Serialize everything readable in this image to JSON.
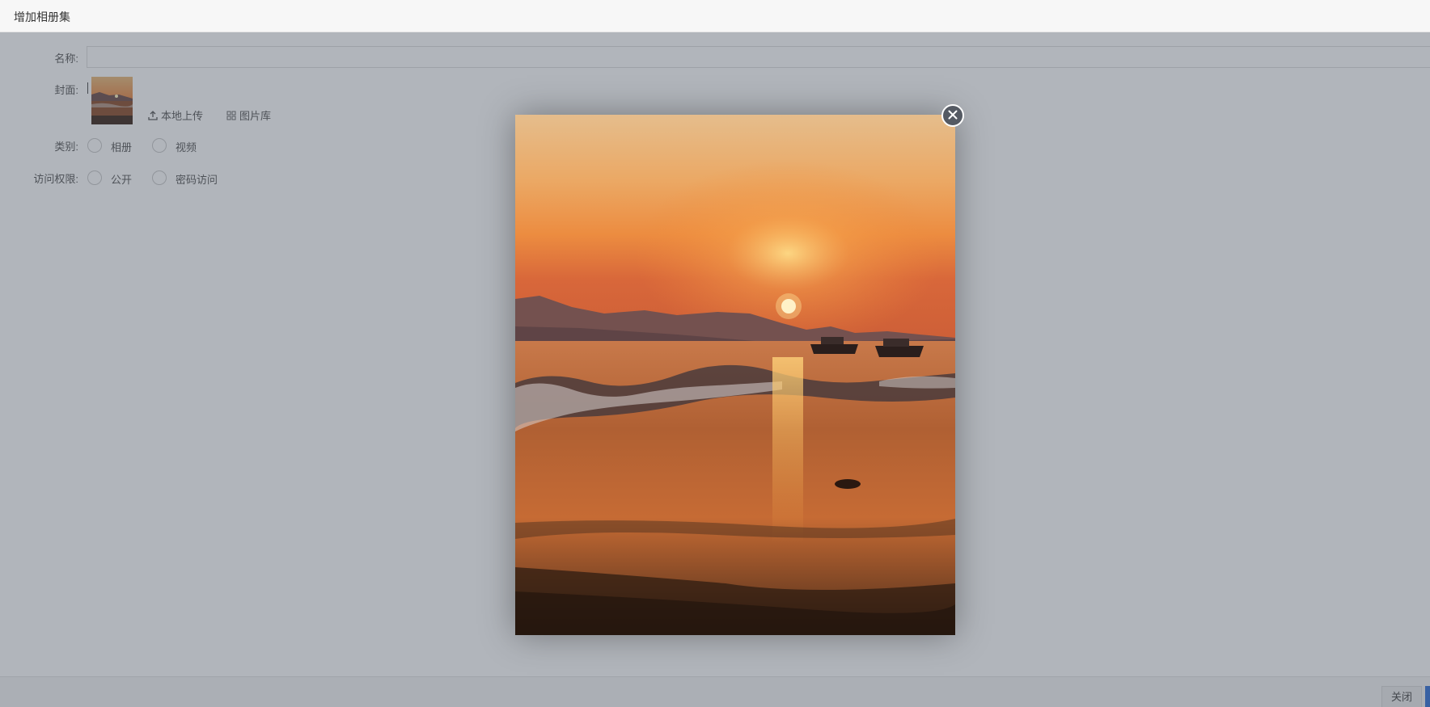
{
  "window": {
    "title": "增加相册集"
  },
  "form": {
    "name_label": "名称:",
    "name_value": "",
    "cover_label": "封面:",
    "upload_local_label": "本地上传",
    "gallery_label": "图片库",
    "category_label": "类别:",
    "category_options": [
      "相册",
      "视频"
    ],
    "access_label": "访问权限:",
    "access_options": [
      "公开",
      "密码访问"
    ]
  },
  "footer": {
    "close_label": "关闭"
  },
  "icons": {
    "upload": "upload-icon",
    "gallery": "grid-icon",
    "preview_close": "close-icon"
  },
  "colors": {
    "overlay": "#464e5c",
    "primary": "#2f6fd6"
  }
}
